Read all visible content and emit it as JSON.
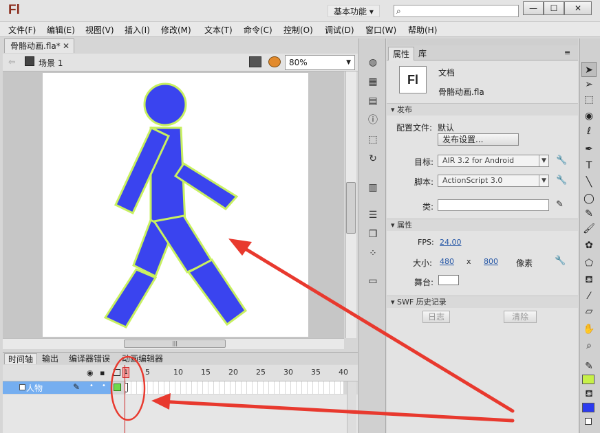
{
  "app": {
    "logo": "Fl",
    "workspace": "基本功能",
    "search_placeholder": "",
    "minimize": "—",
    "maximize": "☐",
    "close": "✕"
  },
  "menu": [
    "文件(F)",
    "编辑(E)",
    "视图(V)",
    "插入(I)",
    "修改(M)",
    "文本(T)",
    "命令(C)",
    "控制(O)",
    "调试(D)",
    "窗口(W)",
    "帮助(H)"
  ],
  "document": {
    "tab": "骨骼动画.fla*",
    "close": "✕",
    "scene": "场景 1",
    "zoom": "80%"
  },
  "colors": {
    "figure_fill": "#3a44ef",
    "figure_stroke": "#c8f060",
    "arrow": "#e8392e",
    "stroke_swatch": "#c7f048",
    "fill_swatch": "#2b3aef"
  },
  "bottom_tabs": [
    "时间轴",
    "输出",
    "编译器错误",
    "动画编辑器"
  ],
  "timeline": {
    "frame_labels": [
      "1",
      "5",
      "10",
      "15",
      "20",
      "25",
      "30",
      "35",
      "40"
    ],
    "layer": "人物",
    "current_frame": "1"
  },
  "properties": {
    "tabs": [
      "属性",
      "库"
    ],
    "doc_label": "文档",
    "doc_file": "骨骼动画.fla",
    "publish": {
      "section": "发布",
      "profile_label": "配置文件:",
      "profile_value": "默认",
      "publish_settings": "发布设置...",
      "target_label": "目标:",
      "target_value": "AIR 3.2 for Android",
      "script_label": "脚本:",
      "script_value": "ActionScript 3.0",
      "class_label": "类:"
    },
    "attrs": {
      "section": "属性",
      "fps_label": "FPS:",
      "fps_value": "24.00",
      "size_label": "大小:",
      "width": "480",
      "x": "x",
      "height": "800",
      "unit": "像素",
      "stage_label": "舞台:"
    },
    "swf": {
      "section": "SWF 历史记录",
      "log": "日志",
      "clear": "清除"
    }
  }
}
